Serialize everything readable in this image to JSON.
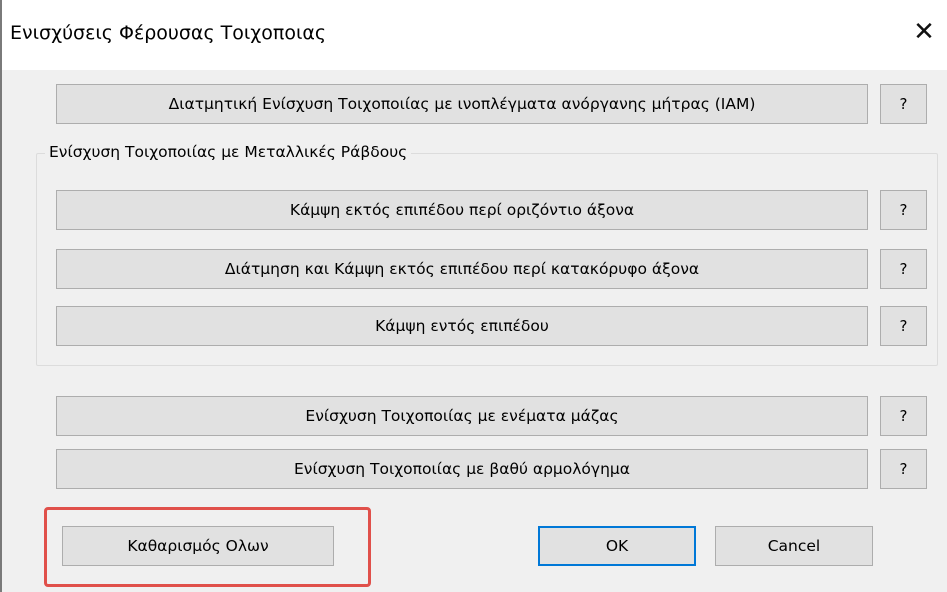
{
  "window": {
    "title": "Ενισχύσεις Φέρουσας Τοιχοποιας",
    "close_glyph": "✕"
  },
  "buttons": {
    "iam": "Διατμητική Ενίσχυση Τοιχοποιίας με ινοπλέγματα ανόργανης μήτρας (ΙΑΜ)",
    "help": "?",
    "metal_group_label": "Ενίσχυση Τοιχοποιίας με Μεταλλικές Ράβδους",
    "bending_horizontal": "Κάμψη εκτός επιπέδου περί οριζόντιο άξονα",
    "shear_bending_vertical": "Διάτμηση και Κάμψη εκτός επιπέδου περί κατακόρυφο άξονα",
    "bending_in_plane": "Κάμψη εντός επιπέδου",
    "grout_injection": "Ενίσχυση Τοιχοποιίας με ενέματα μάζας",
    "deep_repointing": "Ενίσχυση Τοιχοποιίας με βαθύ αρμολόγημα",
    "clear_all": "Καθαρισμός Ολων",
    "ok": "OK",
    "cancel": "Cancel"
  },
  "colors": {
    "dialog_bg": "#f0f0f0",
    "button_bg": "#e1e1e1",
    "default_border": "#0078d7",
    "highlight": "#e0504a"
  }
}
